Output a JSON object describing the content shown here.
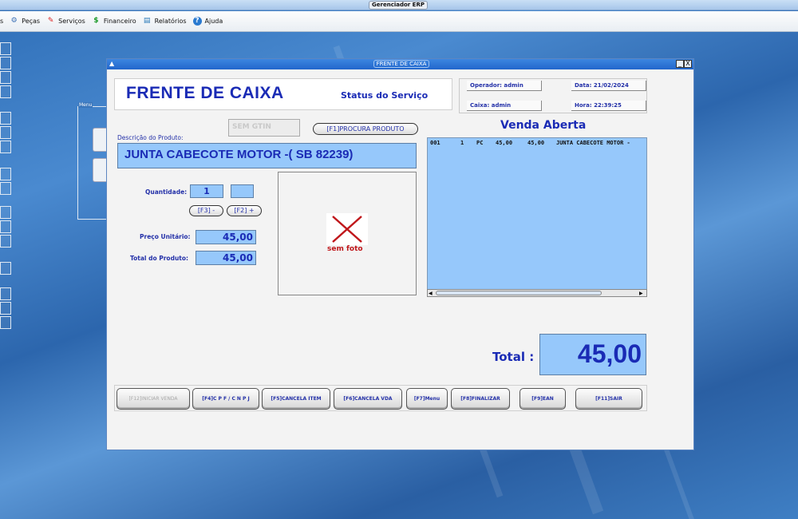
{
  "app": {
    "title": "Gerenciador ERP"
  },
  "menubar": {
    "items": [
      {
        "label": "s"
      },
      {
        "label": "Peças"
      },
      {
        "label": "Serviços"
      },
      {
        "label": "Financeiro"
      },
      {
        "label": "Relatórios"
      },
      {
        "label": "Ajuda"
      }
    ]
  },
  "side_menu": {
    "label": "Menu"
  },
  "window": {
    "title": "FRENTE DE CAIXA",
    "min_glyph": "_",
    "close_glyph": "X"
  },
  "header": {
    "title": "FRENTE DE CAIXA",
    "status": "Status do Serviço",
    "operator": "Operador: admin",
    "date": "Data: 21/02/2024",
    "cashier": "Caixa: admin",
    "time": "Hora: 22:39:25"
  },
  "product": {
    "gtin_placeholder": "SEM GTIN",
    "search_button": "[F1]PROCURA PRODUTO",
    "description_label": "Descrição do Produto:",
    "description": "JUNTA CABECOTE MOTOR -( SB 82239)",
    "quantity_label": "Quantidade:",
    "quantity": "1",
    "quantity_extra": "",
    "minus_button": "[F3] -",
    "plus_button": "[F2] +",
    "unit_price_label": "Preço Unitário:",
    "unit_price": "45,00",
    "total_label": "Total do Produto:",
    "total": "45,00",
    "photo_text": "sem foto"
  },
  "sale": {
    "title": "Venda Aberta",
    "items": [
      {
        "seq": "001",
        "qty": "1",
        "unit": "PC",
        "price": "45,00",
        "total": "45,00",
        "desc": "JUNTA CABECOTE MOTOR -"
      }
    ],
    "total_label": "Total :",
    "total_value": "45,00"
  },
  "actions": {
    "start_sale": "[F12]INICIAR VENDA",
    "cpf": "[F4]C P F / C N P J",
    "cancel_item": "[F5]CANCELA ITEM",
    "cancel_sale": "[F6]CANCELA VDA",
    "menu": "[F7]Menu",
    "finish": "[F8]FINALIZAR",
    "ean": "[F9]EAN",
    "exit": "[F11]SAIR"
  },
  "colors": {
    "accent": "#1a2bb5",
    "field": "#96c8fb",
    "photo_x": "#c0171b"
  }
}
